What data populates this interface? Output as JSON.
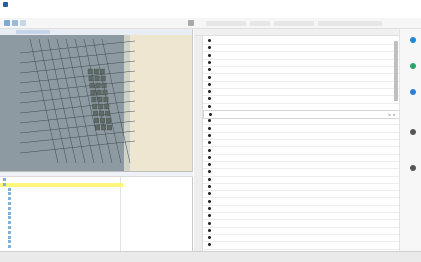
{
  "window": {
    "title": ""
  },
  "menu": [
    "",
    "",
    "",
    "",
    "",
    "",
    "",
    ""
  ],
  "map": {
    "tab_label": "",
    "scale_text": ""
  },
  "tree": {
    "header_label": "",
    "header_value": "",
    "items": [
      "",
      "",
      "",
      "",
      "",
      "",
      "",
      "",
      "",
      "",
      "",
      "",
      "",
      "",
      ""
    ],
    "selected_index": 1
  },
  "list": {
    "columns": [
      "",
      "",
      "",
      "",
      ""
    ],
    "rows": [
      {
        "title": "",
        "sub": "",
        "date": ""
      },
      {
        "title": "",
        "sub": "",
        "date": ""
      },
      {
        "title": "",
        "sub": "",
        "date": ""
      },
      {
        "title": "",
        "sub": "",
        "date": ""
      },
      {
        "title": "",
        "sub": "",
        "date": ""
      },
      {
        "title": "",
        "sub": "",
        "date": ""
      },
      {
        "title": "",
        "sub": "",
        "date": ""
      },
      {
        "title": "",
        "sub": "",
        "date": ""
      },
      {
        "title": "",
        "sub": "",
        "date": ""
      },
      {
        "title": "",
        "sub": "",
        "date": ""
      },
      {
        "title": "",
        "sub": "",
        "date": ""
      },
      {
        "title": "",
        "sub": "",
        "date": ""
      },
      {
        "title": "",
        "sub": "",
        "date": ""
      },
      {
        "title": "",
        "sub": "",
        "date": ""
      },
      {
        "title": "",
        "sub": "",
        "date": ""
      },
      {
        "title": "",
        "sub": "",
        "date": ""
      },
      {
        "title": "",
        "sub": "",
        "date": ""
      },
      {
        "title": "",
        "sub": "",
        "date": ""
      },
      {
        "title": "",
        "sub": "",
        "date": ""
      },
      {
        "title": "",
        "sub": "",
        "date": ""
      },
      {
        "title": "",
        "sub": "",
        "date": ""
      },
      {
        "title": "",
        "sub": "",
        "date": ""
      },
      {
        "title": "",
        "sub": "",
        "date": ""
      },
      {
        "title": "",
        "sub": "",
        "date": ""
      },
      {
        "title": "",
        "sub": "",
        "date": ""
      },
      {
        "title": "",
        "sub": "",
        "date": ""
      },
      {
        "title": "",
        "sub": "",
        "date": ""
      },
      {
        "title": "",
        "sub": "",
        "date": ""
      },
      {
        "title": "",
        "sub": "",
        "date": ""
      }
    ],
    "selected_row": 10
  },
  "statusbar": [
    "",
    "",
    "",
    "",
    "",
    "",
    ""
  ],
  "colors": {
    "accent": "#2a5d9f",
    "sea": "#8e9aa2",
    "coast": "#efe6d2",
    "grid_line": "#3f4a4f",
    "station_block": "#5f6a66",
    "tree_selected": "#fff57a",
    "side_buttons": [
      "#1e88d6",
      "#2aa36b",
      "#2a7ed6",
      "#555555",
      "#555555"
    ]
  }
}
